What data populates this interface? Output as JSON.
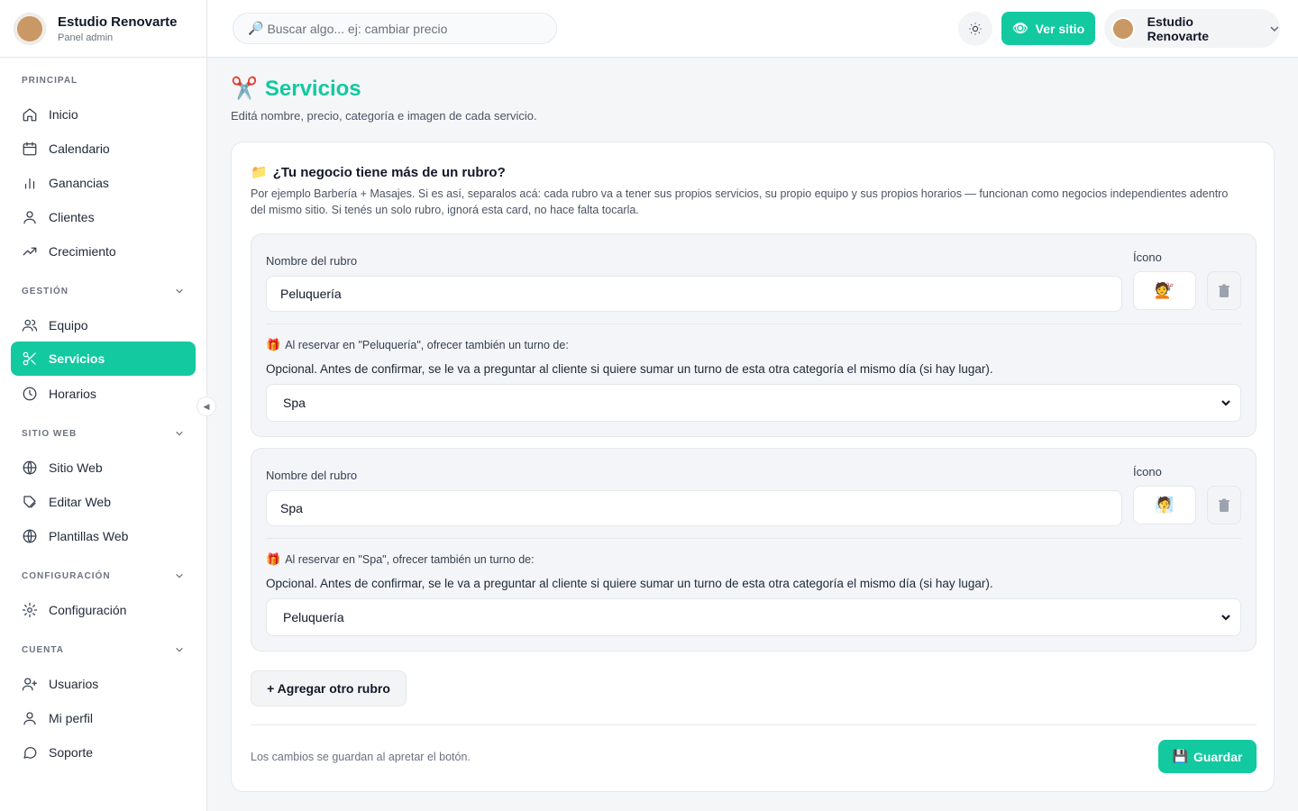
{
  "brand": {
    "name": "Estudio Renovarte",
    "subtitle": "Panel admin"
  },
  "sidebar": {
    "sections": {
      "principal": "PRINCIPAL",
      "gestion": "GESTIÓN",
      "sitio_web": "SITIO WEB",
      "configuracion": "CONFIGURACIÓN",
      "cuenta": "CUENTA"
    },
    "items": {
      "inicio": "Inicio",
      "calendario": "Calendario",
      "ganancias": "Ganancias",
      "clientes": "Clientes",
      "crecimiento": "Crecimiento",
      "equipo": "Equipo",
      "servicios": "Servicios",
      "horarios": "Horarios",
      "sitio_web": "Sitio Web",
      "editar_web": "Editar Web",
      "plantillas_web": "Plantillas Web",
      "configuracion": "Configuración",
      "usuarios": "Usuarios",
      "mi_perfil": "Mi perfil",
      "soporte": "Soporte"
    },
    "active": "servicios"
  },
  "topbar": {
    "search_placeholder": "Buscar algo... ej: cambiar precio",
    "ver_sitio": "Ver sitio",
    "user_name": "Estudio Renovarte"
  },
  "page": {
    "title": "Servicios",
    "subtitle": "Editá nombre, precio, categoría e imagen de cada servicio."
  },
  "card": {
    "title": "¿Tu negocio tiene más de un rubro?",
    "description": "Por ejemplo Barbería + Masajes. Si es así, separalos acá: cada rubro va a tener sus propios servicios, su propio equipo y sus propios horarios — funcionan como negocios independientes adentro del mismo sitio. Si tenés un solo rubro, ignorá esta card, no hace falta tocarla.",
    "name_label": "Nombre del rubro",
    "icon_label": "Ícono",
    "offer_description": "Opcional. Antes de confirmar, se le va a preguntar al cliente si quiere sumar un turno de esta otra categoría el mismo día (si hay lugar).",
    "rubros": [
      {
        "name": "Peluquería",
        "icon": "💇",
        "offer_title": "Al reservar en \"Peluquería\", ofrecer también un turno de:",
        "selected": "Spa"
      },
      {
        "name": "Spa",
        "icon": "🧖",
        "offer_title": "Al reservar en \"Spa\", ofrecer también un turno de:",
        "selected": "Peluquería"
      }
    ],
    "add_button": "+ Agregar otro rubro",
    "save_note": "Los cambios se guardan al apretar el botón.",
    "save_button": "Guardar"
  },
  "colors": {
    "accent": "#12c9a0"
  }
}
